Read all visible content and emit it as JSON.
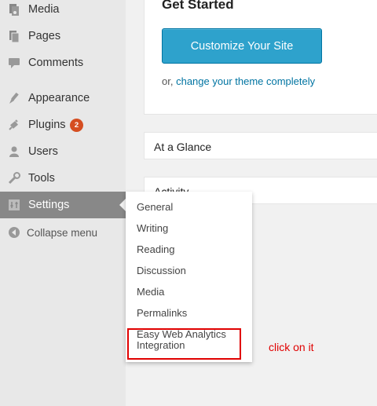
{
  "sidebar": {
    "items": [
      {
        "label": "Media",
        "icon": "media-icon"
      },
      {
        "label": "Pages",
        "icon": "pages-icon"
      },
      {
        "label": "Comments",
        "icon": "comments-icon"
      },
      {
        "label": "Appearance",
        "icon": "appearance-icon"
      },
      {
        "label": "Plugins",
        "icon": "plugins-icon",
        "badge": "2"
      },
      {
        "label": "Users",
        "icon": "users-icon"
      },
      {
        "label": "Tools",
        "icon": "tools-icon"
      },
      {
        "label": "Settings",
        "icon": "settings-icon",
        "active": true
      }
    ],
    "collapse_label": "Collapse menu"
  },
  "welcome": {
    "title": "Get Started",
    "button_label": "Customize Your Site",
    "or_text": "or,",
    "theme_link": "change your theme completely"
  },
  "widgets": {
    "at_a_glance": "At a Glance",
    "activity": "Activity"
  },
  "settings_submenu": {
    "items": [
      "General",
      "Writing",
      "Reading",
      "Discussion",
      "Media",
      "Permalinks",
      "Easy Web Analytics Integration"
    ]
  },
  "annotation": {
    "text": "click on it",
    "color": "#e00000"
  },
  "colors": {
    "accent": "#2ea2cc",
    "link": "#0074a2",
    "badge": "#d54e21",
    "active_menu": "#888888"
  }
}
